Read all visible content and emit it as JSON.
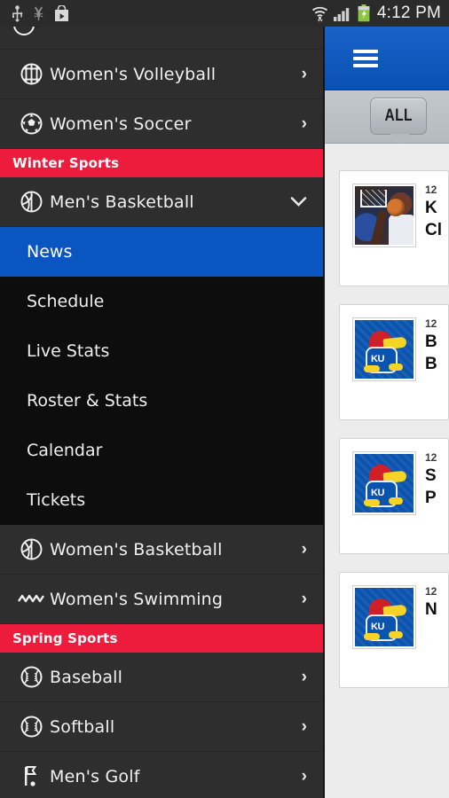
{
  "status_bar": {
    "time": "4:12 PM",
    "left_icons": [
      "usb-icon",
      "usb-debugging-icon",
      "play-store-icon"
    ],
    "right_icons": [
      "wifi-icon",
      "cellular-signal-icon",
      "battery-charging-icon"
    ]
  },
  "app_bar": {
    "menu_icon": "hamburger-menu-icon",
    "background_color": "#0a50b4"
  },
  "filter_bar": {
    "selected_filter": "ALL"
  },
  "drawer": {
    "background_color": "#2e2e2e",
    "section_color": "#ed1b3c",
    "active_color": "#0a56c0",
    "partial_row_top": {
      "label": "",
      "icon": "sport-icon"
    },
    "items": [
      {
        "type": "item",
        "label": "Women's Volleyball",
        "icon": "volleyball-icon",
        "chevron": "›"
      },
      {
        "type": "item",
        "label": "Women's Soccer",
        "icon": "soccer-ball-icon",
        "chevron": "›"
      },
      {
        "type": "section",
        "label": "Winter Sports"
      },
      {
        "type": "expanded",
        "label": "Men's Basketball",
        "icon": "basketball-icon",
        "chevron": "⌄"
      },
      {
        "type": "sub",
        "label": "News",
        "active": true
      },
      {
        "type": "sub",
        "label": "Schedule",
        "active": false
      },
      {
        "type": "sub",
        "label": "Live Stats",
        "active": false
      },
      {
        "type": "sub",
        "label": "Roster & Stats",
        "active": false
      },
      {
        "type": "sub",
        "label": "Calendar",
        "active": false
      },
      {
        "type": "sub",
        "label": "Tickets",
        "active": false
      },
      {
        "type": "item",
        "label": "Women's Basketball",
        "icon": "basketball-icon",
        "chevron": "›"
      },
      {
        "type": "item",
        "label": "Women's Swimming",
        "icon": "swimming-waves-icon",
        "chevron": "›"
      },
      {
        "type": "section",
        "label": "Spring Sports"
      },
      {
        "type": "item",
        "label": "Baseball",
        "icon": "baseball-icon",
        "chevron": "›"
      },
      {
        "type": "item",
        "label": "Softball",
        "icon": "baseball-icon",
        "chevron": "›"
      },
      {
        "type": "item",
        "label": "Men's Golf",
        "icon": "golf-flag-icon",
        "chevron": "›"
      }
    ]
  },
  "news_list": {
    "cards": [
      {
        "date": "12",
        "title_line1": "K",
        "title_line2": "Cl",
        "thumb": "basketball-action-photo"
      },
      {
        "date": "12",
        "title_line1": "B",
        "title_line2": "B",
        "thumb": "ku-jayhawk-logo"
      },
      {
        "date": "12",
        "title_line1": "S",
        "title_line2": "P",
        "thumb": "ku-jayhawk-logo"
      },
      {
        "date": "12",
        "title_line1": "N",
        "title_line2": "",
        "thumb": "ku-jayhawk-logo"
      }
    ]
  }
}
